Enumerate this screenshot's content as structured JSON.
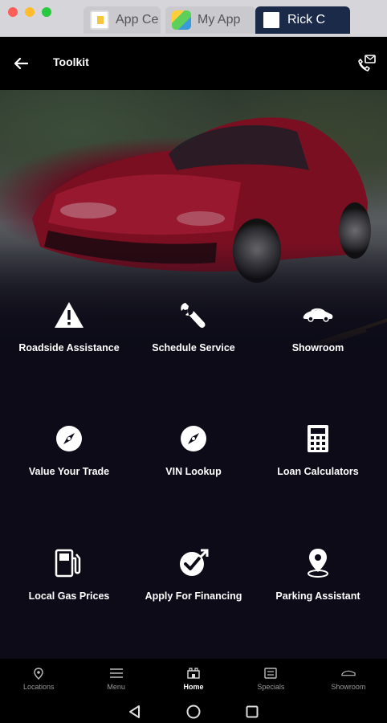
{
  "window": {
    "tabs": [
      {
        "label": "App Ce",
        "icon": "app-center-icon"
      },
      {
        "label": "My App",
        "icon": "my-apps-icon"
      },
      {
        "label": "Rick C",
        "icon": "rick-icon"
      }
    ],
    "colors": {
      "close": "#fe5f57",
      "minimize": "#febc2e",
      "zoom": "#28c840"
    }
  },
  "header": {
    "title": "Toolkit",
    "back_icon": "arrow-left-icon",
    "action_icon": "phone-message-icon"
  },
  "tiles": [
    {
      "label": "Roadside Assistance",
      "icon": "warning-triangle-icon"
    },
    {
      "label": "Schedule Service",
      "icon": "wrench-icon"
    },
    {
      "label": "Showroom",
      "icon": "car-icon"
    },
    {
      "label": "Value Your Trade",
      "icon": "compass-icon"
    },
    {
      "label": "VIN Lookup",
      "icon": "compass-icon"
    },
    {
      "label": "Loan Calculators",
      "icon": "calculator-icon"
    },
    {
      "label": "Local Gas Prices",
      "icon": "gas-pump-icon"
    },
    {
      "label": "Apply For Financing",
      "icon": "check-badge-icon"
    },
    {
      "label": "Parking Assistant",
      "icon": "location-pin-icon"
    }
  ],
  "bottom_nav": {
    "active": "Home",
    "items": [
      {
        "label": "Locations",
        "icon": "map-pin-icon"
      },
      {
        "label": "Menu",
        "icon": "hamburger-icon"
      },
      {
        "label": "Home",
        "icon": "home-icon"
      },
      {
        "label": "Specials",
        "icon": "tag-icon"
      },
      {
        "label": "Showroom",
        "icon": "car-outline-icon"
      }
    ]
  },
  "system_nav": [
    "back-icon",
    "home-circle-icon",
    "recents-icon"
  ],
  "colors": {
    "background": "#0c0b17",
    "bar": "#000000",
    "hero_accent": "#8a1226"
  }
}
